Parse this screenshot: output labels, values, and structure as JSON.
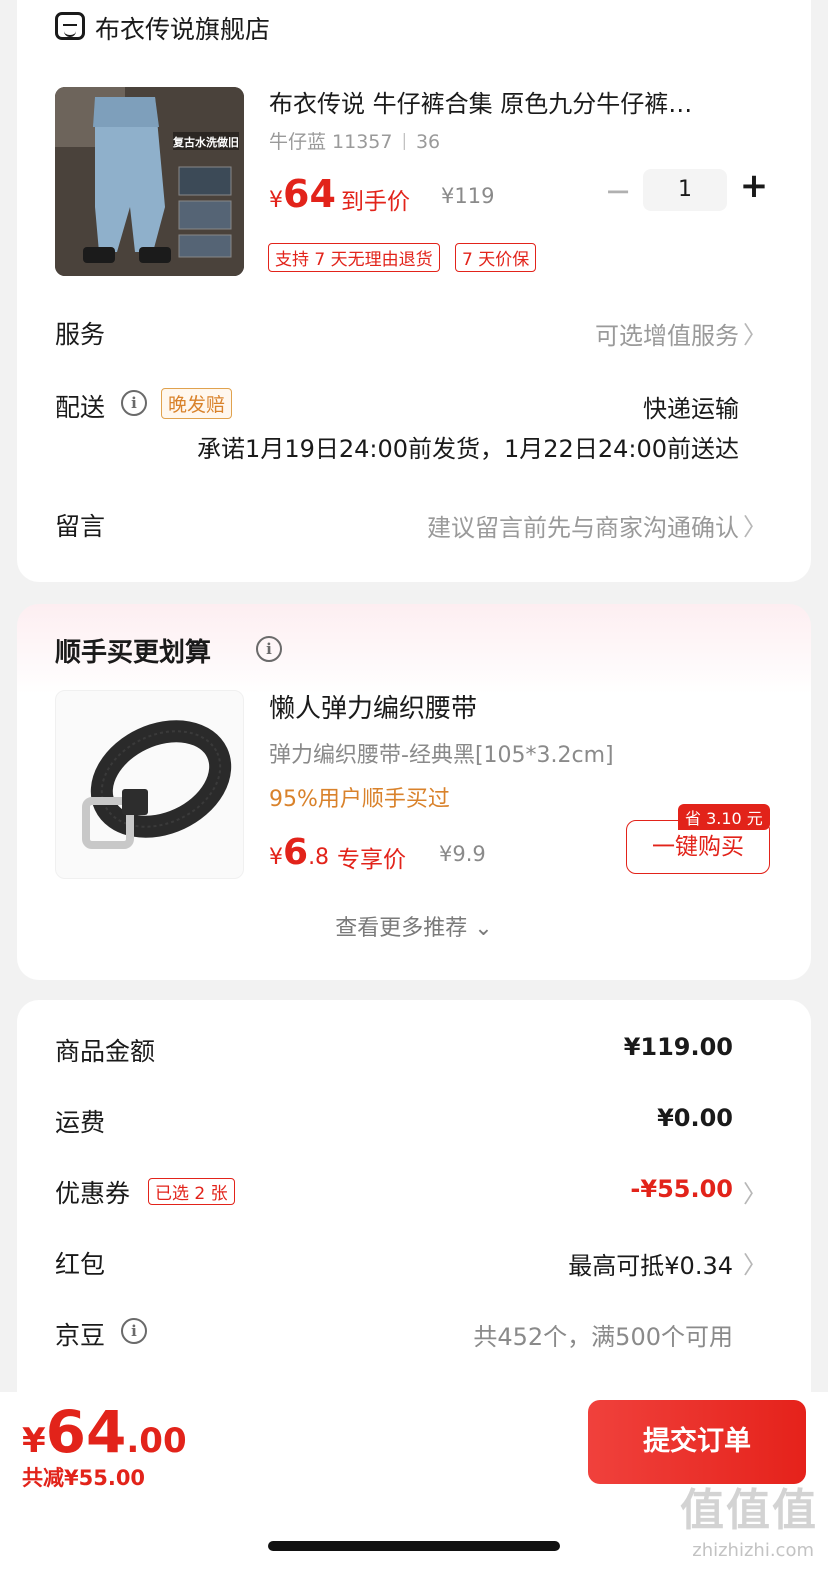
{
  "store": {
    "name": "布衣传说旗舰店",
    "icon": "store-icon"
  },
  "product": {
    "title": "布衣传说 牛仔裤合集 原色九分牛仔裤…",
    "sku": "牛仔蓝 11357 ᛁ 36",
    "image_caption": "复古水洗做旧",
    "price_symbol": "¥",
    "price": "64",
    "price_tag": "到手价",
    "original_price": "¥119",
    "quantity": "1",
    "qty_minus": "−",
    "qty_plus": "+",
    "tags": [
      "支持 7 天无理由退货",
      "7 天价保"
    ]
  },
  "rows": {
    "service_label": "服务",
    "service_value": "可选增值服务",
    "shipping_label": "配送",
    "shipping_badge": "晚发赔",
    "shipping_method": "快递运输",
    "shipping_promise": "承诺1月19日24:00前发货，1月22日24:00前送达",
    "message_label": "留言",
    "message_placeholder": "建议留言前先与商家沟通确认",
    "chevron": "〉",
    "info": "i"
  },
  "addon": {
    "section_title": "顺手买更划算",
    "name": "懒人弹力编织腰带",
    "sku": "弹力编织腰带-经典黑[105*3.2cm]",
    "social_proof": "95%用户顺手买过",
    "price_symbol": "¥",
    "price_int": "6",
    "price_dec": ".8",
    "price_tag": "专享价",
    "original_price": "¥9.9",
    "buy_button": "一键购买",
    "save_badge": "省 3.10 元",
    "more": "查看更多推荐 ⌄"
  },
  "summary": {
    "items": [
      {
        "label": "商品金额",
        "value": "¥119.00"
      },
      {
        "label": "运费",
        "value": "¥0.00"
      },
      {
        "label": "优惠券",
        "badge": "已选 2 张",
        "value": "-¥55.00"
      },
      {
        "label": "红包",
        "value": "最高可抵¥0.34"
      },
      {
        "label": "京豆",
        "value": "共452个，满500个可用"
      }
    ]
  },
  "checkout": {
    "currency": "¥",
    "total_int": "64",
    "total_dec": ".00",
    "saved": "共减¥55.00",
    "submit": "提交订单"
  },
  "watermark": {
    "text": "值值值",
    "sub": "zhizhizhi.com"
  },
  "colors": {
    "accent": "#e2231a",
    "orange": "#d9822b",
    "muted": "#9a9a9a"
  }
}
